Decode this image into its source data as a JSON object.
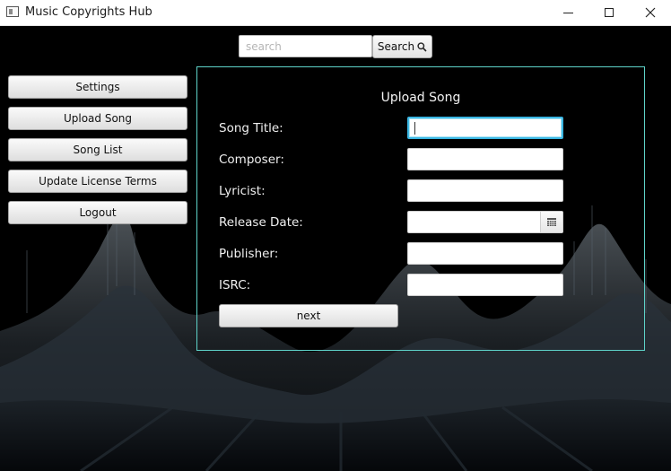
{
  "window": {
    "title": "Music Copyrights Hub"
  },
  "search": {
    "placeholder": "search",
    "value": "",
    "button_label": "Search"
  },
  "sidebar": {
    "items": [
      {
        "label": "Settings"
      },
      {
        "label": "Upload Song"
      },
      {
        "label": "Song List"
      },
      {
        "label": "Update License Terms"
      },
      {
        "label": "Logout"
      }
    ]
  },
  "form": {
    "title": "Upload Song",
    "fields": [
      {
        "label": "Song Title:",
        "value": ""
      },
      {
        "label": "Composer:",
        "value": ""
      },
      {
        "label": "Lyricist:",
        "value": ""
      },
      {
        "label": "Release Date:",
        "value": ""
      },
      {
        "label": "Publisher:",
        "value": ""
      },
      {
        "label": "ISRC:",
        "value": ""
      }
    ],
    "next_label": "next"
  },
  "colors": {
    "panel_border": "#5ed3c9",
    "focus": "#3bb7e3",
    "background": "#000000"
  }
}
